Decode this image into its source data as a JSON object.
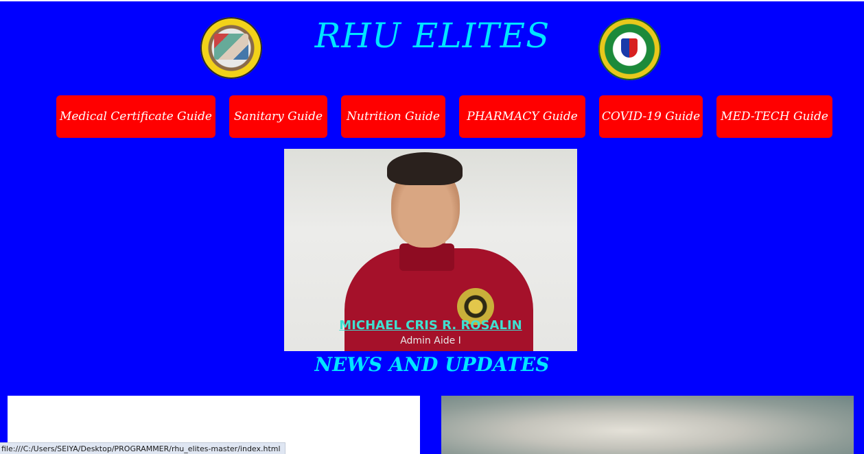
{
  "header": {
    "title": "RHU ELITES",
    "left_seal_icon": "municipality-of-manaoag-seal",
    "right_seal_icon": "department-of-health-seal"
  },
  "nav": [
    {
      "label": "Medical Certificate Guide"
    },
    {
      "label": "Sanitary Guide"
    },
    {
      "label": "Nutrition Guide"
    },
    {
      "label": "PHARMACY Guide"
    },
    {
      "label": "COVID-19 Guide"
    },
    {
      "label": "MED-TECH Guide"
    }
  ],
  "profile": {
    "name": "MICHAEL CRIS R. ROSALIN",
    "role": "Admin Aide I"
  },
  "news": {
    "title": "NEWS AND UPDATES"
  },
  "status_bar": {
    "url": "file:///C:/Users/SEIYA/Desktop/PROGRAMMER/rhu_elites-master/index.html"
  },
  "colors": {
    "background": "#0000ff",
    "title": "#00e5ff",
    "nav_button": "#ff0000",
    "profile_name": "#40e0d0"
  }
}
